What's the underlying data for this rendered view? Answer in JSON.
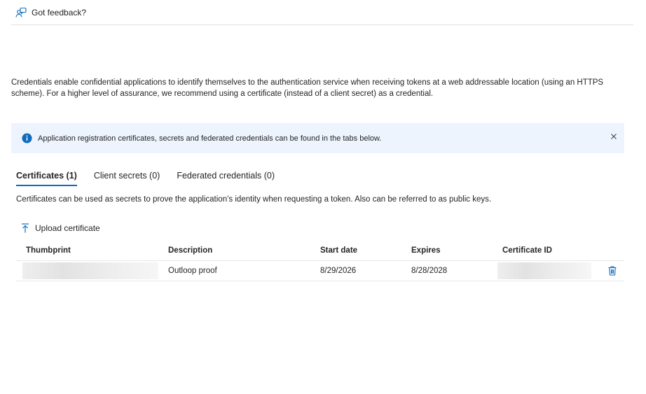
{
  "toolbar": {
    "feedback_label": "Got feedback?",
    "feedback_icon": "feedback-person-icon"
  },
  "intro": {
    "text": "Credentials enable confidential applications to identify themselves to the authentication service when receiving tokens at a web addressable location (using an HTTPS scheme). For a higher level of assurance, we recommend using a certificate (instead of a client secret) as a credential."
  },
  "banner": {
    "message": "Application registration certificates, secrets and federated credentials can be found in the tabs below.",
    "icon": "info-icon",
    "close_icon": "close-icon",
    "background": "#eef4fd",
    "icon_color": "#0f6cbd"
  },
  "tabs": [
    {
      "label": "Certificates (1)",
      "active": true
    },
    {
      "label": "Client secrets (0)",
      "active": false
    },
    {
      "label": "Federated credentials (0)",
      "active": false
    }
  ],
  "certificates": {
    "description": "Certificates can be used as secrets to prove the application’s identity when requesting a token. Also can be referred to as public keys.",
    "upload_label": "Upload certificate",
    "columns": [
      "Thumbprint",
      "Description",
      "Start date",
      "Expires",
      "Certificate ID"
    ],
    "rows": [
      {
        "description": "Outloop proof",
        "start_date": "8/29/2026",
        "expires": "8/28/2028",
        "delete_icon": "trash-icon"
      }
    ]
  },
  "colors": {
    "accent": "#0f6cbd",
    "text": "#242424",
    "divider": "#e1e1e1"
  }
}
